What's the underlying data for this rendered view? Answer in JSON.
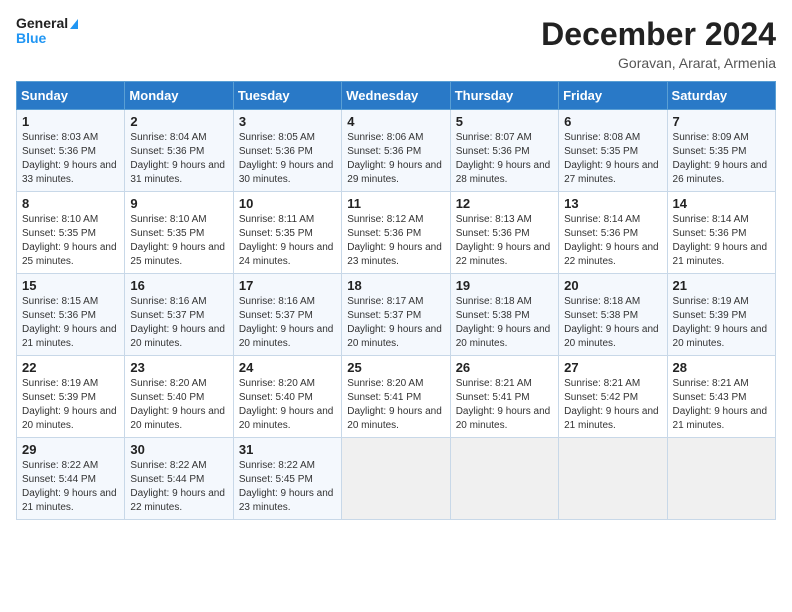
{
  "header": {
    "logo_line1": "General",
    "logo_line2": "Blue",
    "month_title": "December 2024",
    "location": "Goravan, Ararat, Armenia"
  },
  "weekdays": [
    "Sunday",
    "Monday",
    "Tuesday",
    "Wednesday",
    "Thursday",
    "Friday",
    "Saturday"
  ],
  "weeks": [
    [
      {
        "day": "1",
        "sunrise": "8:03 AM",
        "sunset": "5:36 PM",
        "daylight": "9 hours and 33 minutes."
      },
      {
        "day": "2",
        "sunrise": "8:04 AM",
        "sunset": "5:36 PM",
        "daylight": "9 hours and 31 minutes."
      },
      {
        "day": "3",
        "sunrise": "8:05 AM",
        "sunset": "5:36 PM",
        "daylight": "9 hours and 30 minutes."
      },
      {
        "day": "4",
        "sunrise": "8:06 AM",
        "sunset": "5:36 PM",
        "daylight": "9 hours and 29 minutes."
      },
      {
        "day": "5",
        "sunrise": "8:07 AM",
        "sunset": "5:36 PM",
        "daylight": "9 hours and 28 minutes."
      },
      {
        "day": "6",
        "sunrise": "8:08 AM",
        "sunset": "5:35 PM",
        "daylight": "9 hours and 27 minutes."
      },
      {
        "day": "7",
        "sunrise": "8:09 AM",
        "sunset": "5:35 PM",
        "daylight": "9 hours and 26 minutes."
      }
    ],
    [
      {
        "day": "8",
        "sunrise": "8:10 AM",
        "sunset": "5:35 PM",
        "daylight": "9 hours and 25 minutes."
      },
      {
        "day": "9",
        "sunrise": "8:10 AM",
        "sunset": "5:35 PM",
        "daylight": "9 hours and 25 minutes."
      },
      {
        "day": "10",
        "sunrise": "8:11 AM",
        "sunset": "5:35 PM",
        "daylight": "9 hours and 24 minutes."
      },
      {
        "day": "11",
        "sunrise": "8:12 AM",
        "sunset": "5:36 PM",
        "daylight": "9 hours and 23 minutes."
      },
      {
        "day": "12",
        "sunrise": "8:13 AM",
        "sunset": "5:36 PM",
        "daylight": "9 hours and 22 minutes."
      },
      {
        "day": "13",
        "sunrise": "8:14 AM",
        "sunset": "5:36 PM",
        "daylight": "9 hours and 22 minutes."
      },
      {
        "day": "14",
        "sunrise": "8:14 AM",
        "sunset": "5:36 PM",
        "daylight": "9 hours and 21 minutes."
      }
    ],
    [
      {
        "day": "15",
        "sunrise": "8:15 AM",
        "sunset": "5:36 PM",
        "daylight": "9 hours and 21 minutes."
      },
      {
        "day": "16",
        "sunrise": "8:16 AM",
        "sunset": "5:37 PM",
        "daylight": "9 hours and 20 minutes."
      },
      {
        "day": "17",
        "sunrise": "8:16 AM",
        "sunset": "5:37 PM",
        "daylight": "9 hours and 20 minutes."
      },
      {
        "day": "18",
        "sunrise": "8:17 AM",
        "sunset": "5:37 PM",
        "daylight": "9 hours and 20 minutes."
      },
      {
        "day": "19",
        "sunrise": "8:18 AM",
        "sunset": "5:38 PM",
        "daylight": "9 hours and 20 minutes."
      },
      {
        "day": "20",
        "sunrise": "8:18 AM",
        "sunset": "5:38 PM",
        "daylight": "9 hours and 20 minutes."
      },
      {
        "day": "21",
        "sunrise": "8:19 AM",
        "sunset": "5:39 PM",
        "daylight": "9 hours and 20 minutes."
      }
    ],
    [
      {
        "day": "22",
        "sunrise": "8:19 AM",
        "sunset": "5:39 PM",
        "daylight": "9 hours and 20 minutes."
      },
      {
        "day": "23",
        "sunrise": "8:20 AM",
        "sunset": "5:40 PM",
        "daylight": "9 hours and 20 minutes."
      },
      {
        "day": "24",
        "sunrise": "8:20 AM",
        "sunset": "5:40 PM",
        "daylight": "9 hours and 20 minutes."
      },
      {
        "day": "25",
        "sunrise": "8:20 AM",
        "sunset": "5:41 PM",
        "daylight": "9 hours and 20 minutes."
      },
      {
        "day": "26",
        "sunrise": "8:21 AM",
        "sunset": "5:41 PM",
        "daylight": "9 hours and 20 minutes."
      },
      {
        "day": "27",
        "sunrise": "8:21 AM",
        "sunset": "5:42 PM",
        "daylight": "9 hours and 21 minutes."
      },
      {
        "day": "28",
        "sunrise": "8:21 AM",
        "sunset": "5:43 PM",
        "daylight": "9 hours and 21 minutes."
      }
    ],
    [
      {
        "day": "29",
        "sunrise": "8:22 AM",
        "sunset": "5:44 PM",
        "daylight": "9 hours and 21 minutes."
      },
      {
        "day": "30",
        "sunrise": "8:22 AM",
        "sunset": "5:44 PM",
        "daylight": "9 hours and 22 minutes."
      },
      {
        "day": "31",
        "sunrise": "8:22 AM",
        "sunset": "5:45 PM",
        "daylight": "9 hours and 23 minutes."
      },
      null,
      null,
      null,
      null
    ]
  ],
  "labels": {
    "sunrise": "Sunrise:",
    "sunset": "Sunset:",
    "daylight": "Daylight hours"
  }
}
